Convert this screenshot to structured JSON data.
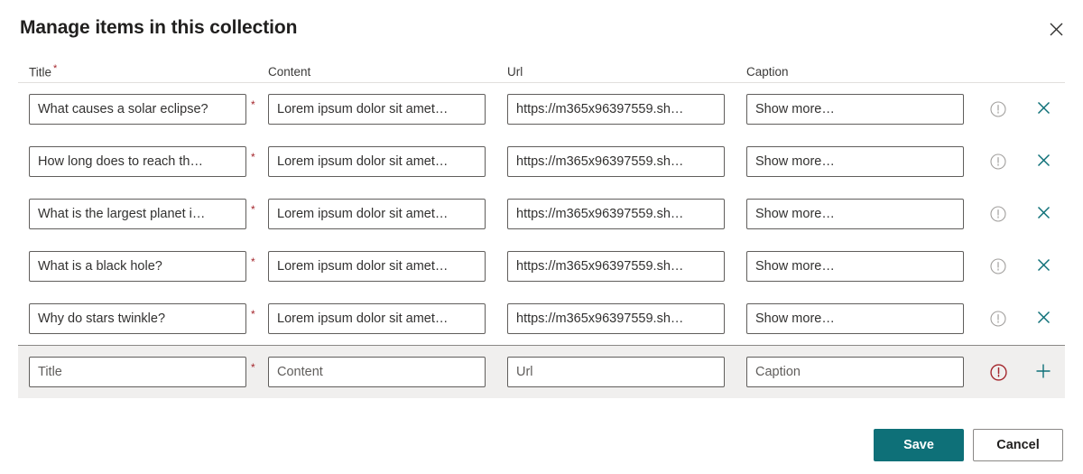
{
  "dialog": {
    "title": "Manage items in this collection",
    "close_icon": "close-icon"
  },
  "grid": {
    "columns": [
      {
        "key": "title",
        "label": "Title",
        "required": true,
        "required_marker": "*"
      },
      {
        "key": "content",
        "label": "Content",
        "required": false,
        "required_marker": ""
      },
      {
        "key": "url",
        "label": "Url",
        "required": false,
        "required_marker": ""
      },
      {
        "key": "caption",
        "label": "Caption",
        "required": false,
        "required_marker": ""
      }
    ],
    "row_required_marker": "*",
    "rows": [
      {
        "title": "What causes a solar eclipse?",
        "content": "Lorem ipsum dolor sit amet…",
        "url": "https://m365x96397559.sh…",
        "caption": "Show more…",
        "status_icon": "info-circle-icon",
        "status_state": "neutral",
        "action_icon": "close-icon",
        "action_label": "Remove item"
      },
      {
        "title": "How long does to reach th…",
        "content": "Lorem ipsum dolor sit amet…",
        "url": "https://m365x96397559.sh…",
        "caption": "Show more…",
        "status_icon": "info-circle-icon",
        "status_state": "neutral",
        "action_icon": "close-icon",
        "action_label": "Remove item"
      },
      {
        "title": "What is the largest planet i…",
        "content": "Lorem ipsum dolor sit amet…",
        "url": "https://m365x96397559.sh…",
        "caption": "Show more…",
        "status_icon": "info-circle-icon",
        "status_state": "neutral",
        "action_icon": "close-icon",
        "action_label": "Remove item"
      },
      {
        "title": "What is a black hole?",
        "content": "Lorem ipsum dolor sit amet…",
        "url": "https://m365x96397559.sh…",
        "caption": "Show more…",
        "status_icon": "info-circle-icon",
        "status_state": "neutral",
        "action_icon": "close-icon",
        "action_label": "Remove item"
      },
      {
        "title": "Why do stars twinkle?",
        "content": "Lorem ipsum dolor sit amet…",
        "url": "https://m365x96397559.sh…",
        "caption": "Show more…",
        "status_icon": "info-circle-icon",
        "status_state": "neutral",
        "action_icon": "close-icon",
        "action_label": "Remove item"
      }
    ],
    "new_row": {
      "title": "",
      "content": "",
      "url": "",
      "caption": "",
      "title_placeholder": "Title",
      "content_placeholder": "Content",
      "url_placeholder": "Url",
      "caption_placeholder": "Caption",
      "status_icon": "error-circle-icon",
      "status_state": "error",
      "action_icon": "add-icon",
      "action_label": "Add item"
    }
  },
  "footer": {
    "save_label": "Save",
    "cancel_label": "Cancel"
  },
  "colors": {
    "accent_teal": "#0e7078",
    "required_red": "#a4262c",
    "error_red": "#a4262c",
    "neutral_gray": "#8a8886",
    "row_highlight": "#f0efee",
    "text_primary": "#323130"
  }
}
